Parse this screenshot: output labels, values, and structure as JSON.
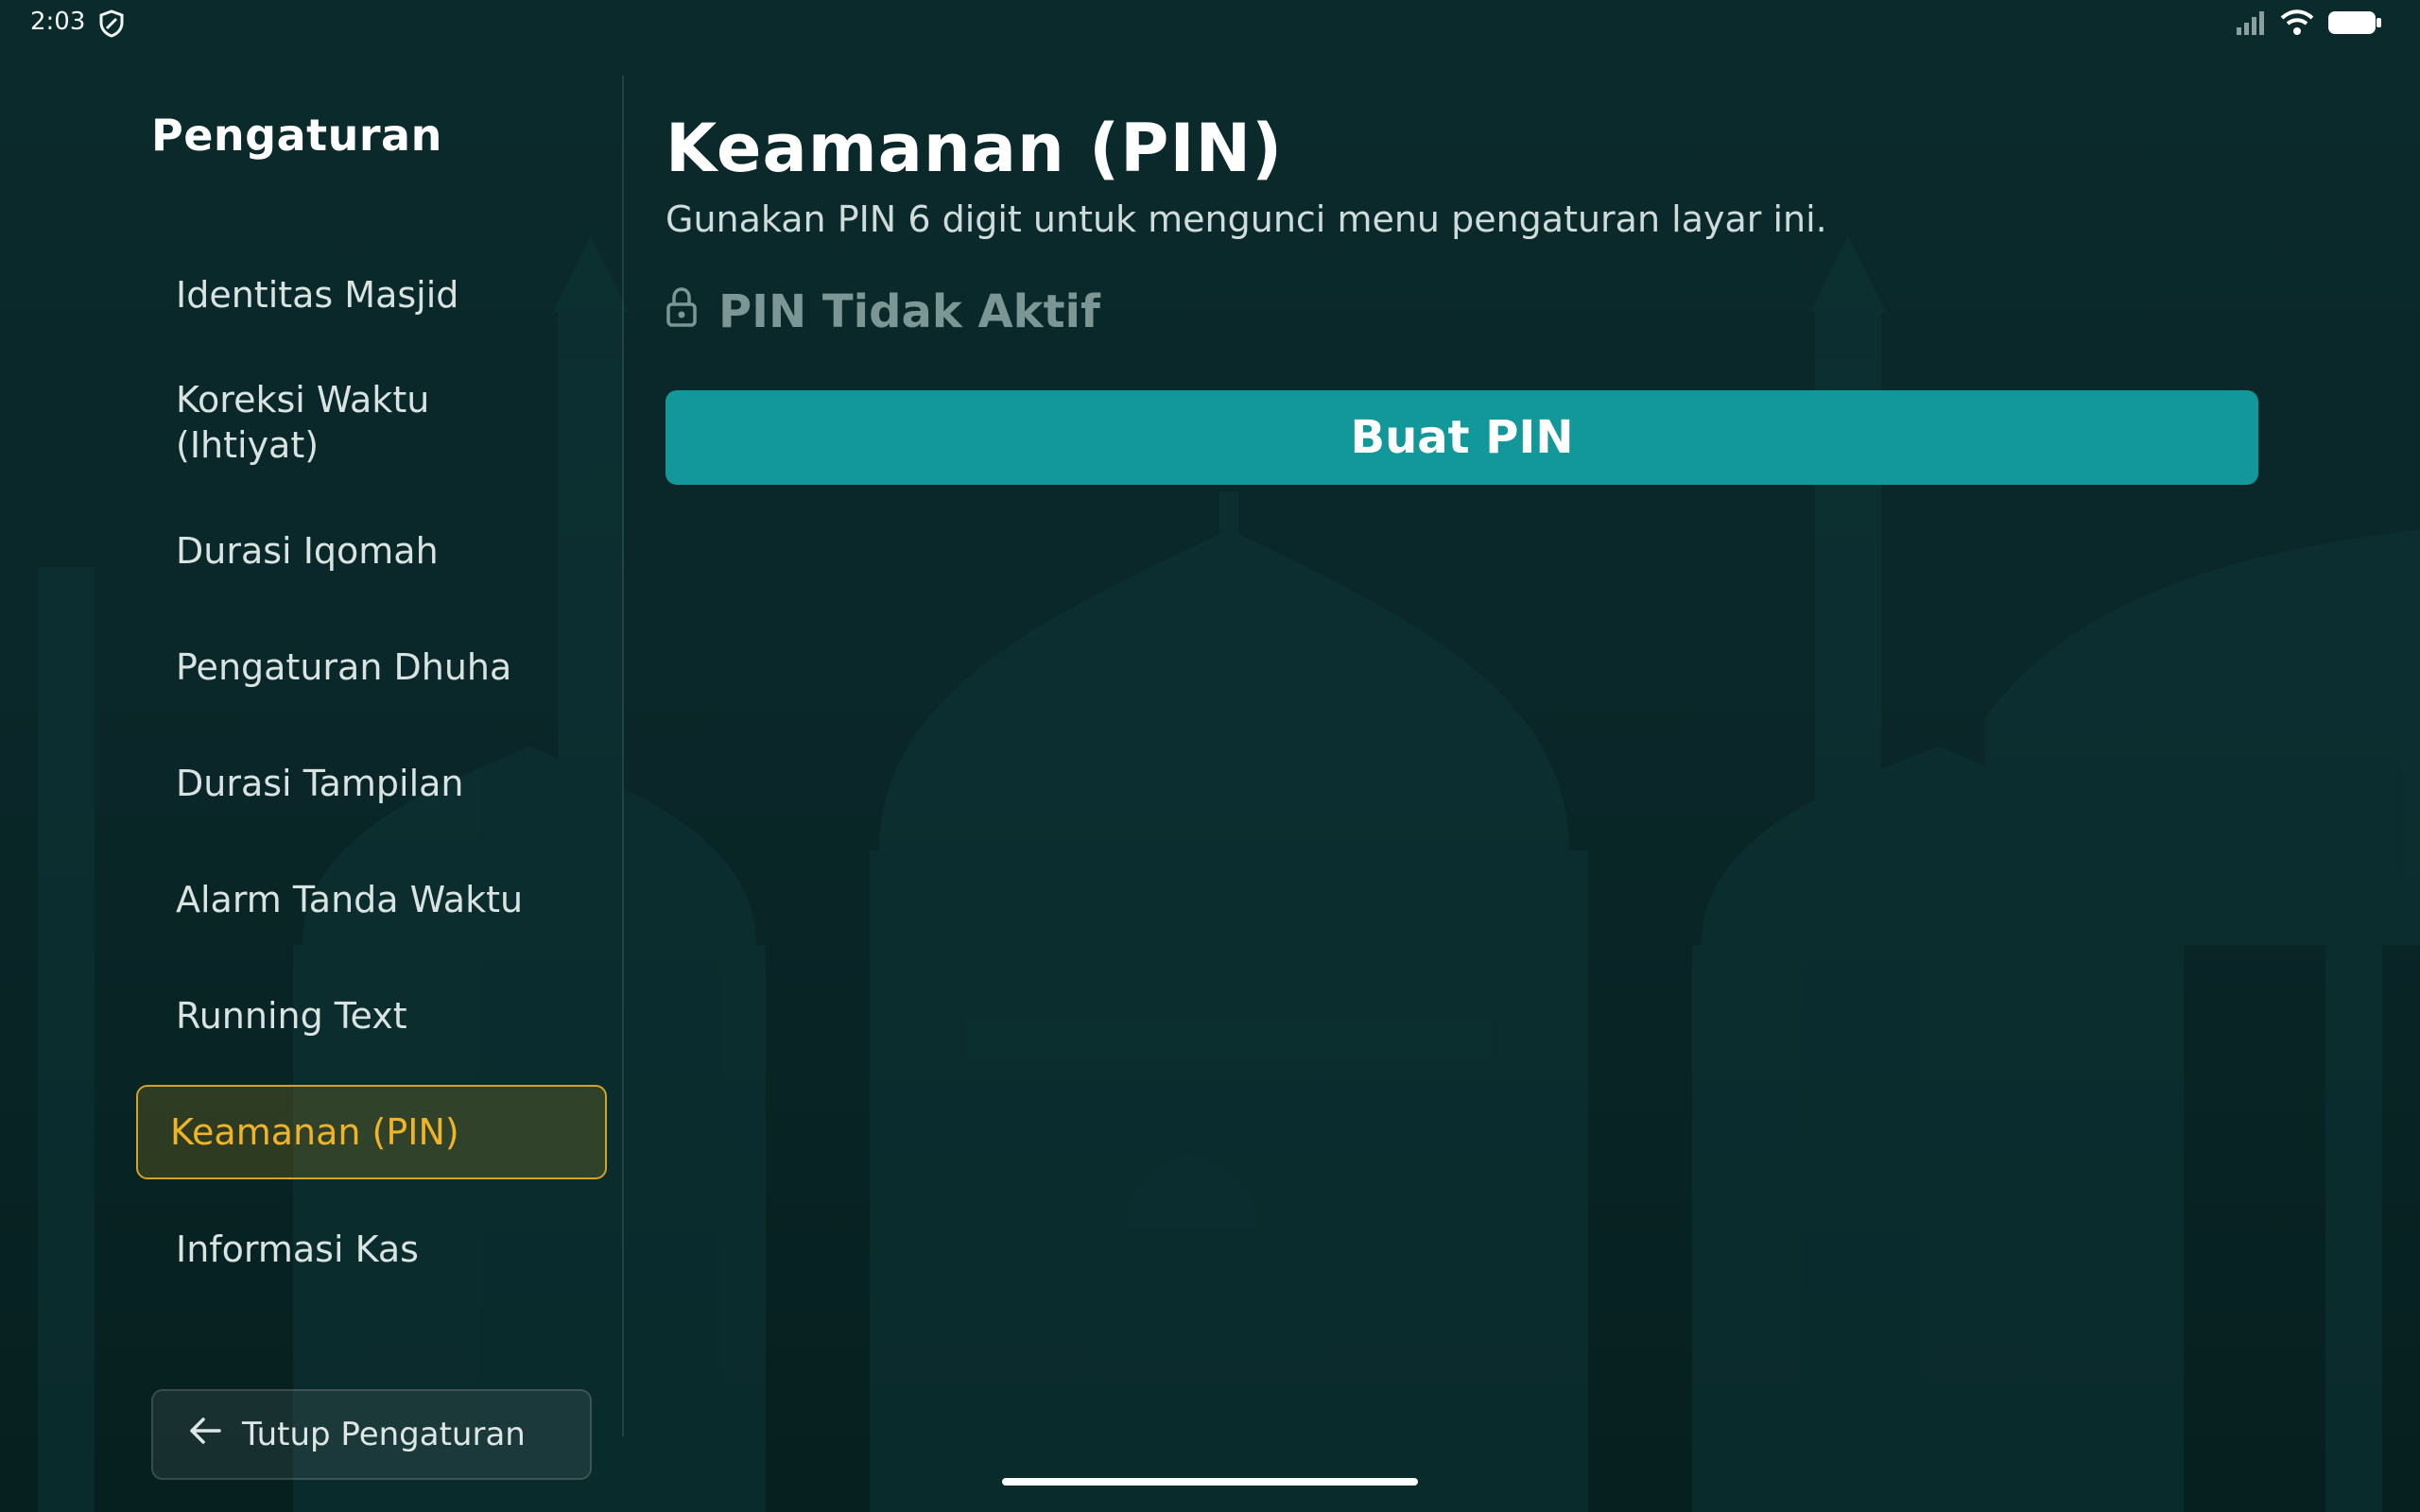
{
  "status_bar": {
    "time": "2:03"
  },
  "sidebar": {
    "title": "Pengaturan",
    "items": [
      {
        "label": "Identitas Masjid",
        "active": false
      },
      {
        "label": "Koreksi Waktu (Ihtiyat)",
        "active": false
      },
      {
        "label": "Durasi Iqomah",
        "active": false
      },
      {
        "label": "Pengaturan Dhuha",
        "active": false
      },
      {
        "label": "Durasi Tampilan",
        "active": false
      },
      {
        "label": "Alarm Tanda Waktu",
        "active": false
      },
      {
        "label": "Running Text",
        "active": false
      },
      {
        "label": "Keamanan (PIN)",
        "active": true
      },
      {
        "label": "Informasi Kas",
        "active": false
      }
    ],
    "close_label": "Tutup Pengaturan"
  },
  "main": {
    "title": "Keamanan (PIN)",
    "description": "Gunakan PIN 6 digit untuk mengunci menu pengaturan layar ini.",
    "pin_status": "PIN Tidak Aktif",
    "create_button_label": "Buat PIN"
  },
  "colors": {
    "background": "#0a2729",
    "accent": "#12989a",
    "active_highlight": "#f0b426",
    "muted_status": "#7c9695"
  },
  "icons": {
    "status_shield": "shield-icon",
    "signal": "signal-icon",
    "wifi": "wifi-icon",
    "battery": "battery-icon",
    "lock": "lock-icon",
    "back_arrow": "arrow-left-icon"
  }
}
